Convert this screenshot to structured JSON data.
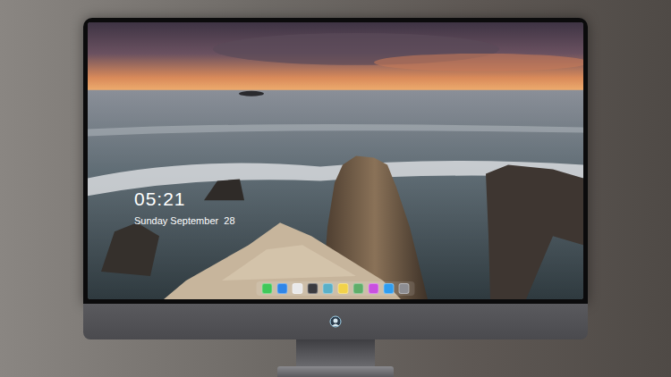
{
  "lock_screen": {
    "time": "05:21",
    "date": "Sunday September  28"
  },
  "dock": {
    "items": [
      {
        "color": "#3fc85a"
      },
      {
        "color": "#2f86e8"
      },
      {
        "color": "#e9e9ea"
      },
      {
        "color": "#3b3b3f"
      },
      {
        "color": "#5ab0c8"
      },
      {
        "color": "#f2d24a"
      },
      {
        "color": "#5fae6a"
      },
      {
        "color": "#c950e0"
      },
      {
        "color": "#2f9df0"
      },
      {
        "color": "#8d8d92"
      }
    ]
  }
}
